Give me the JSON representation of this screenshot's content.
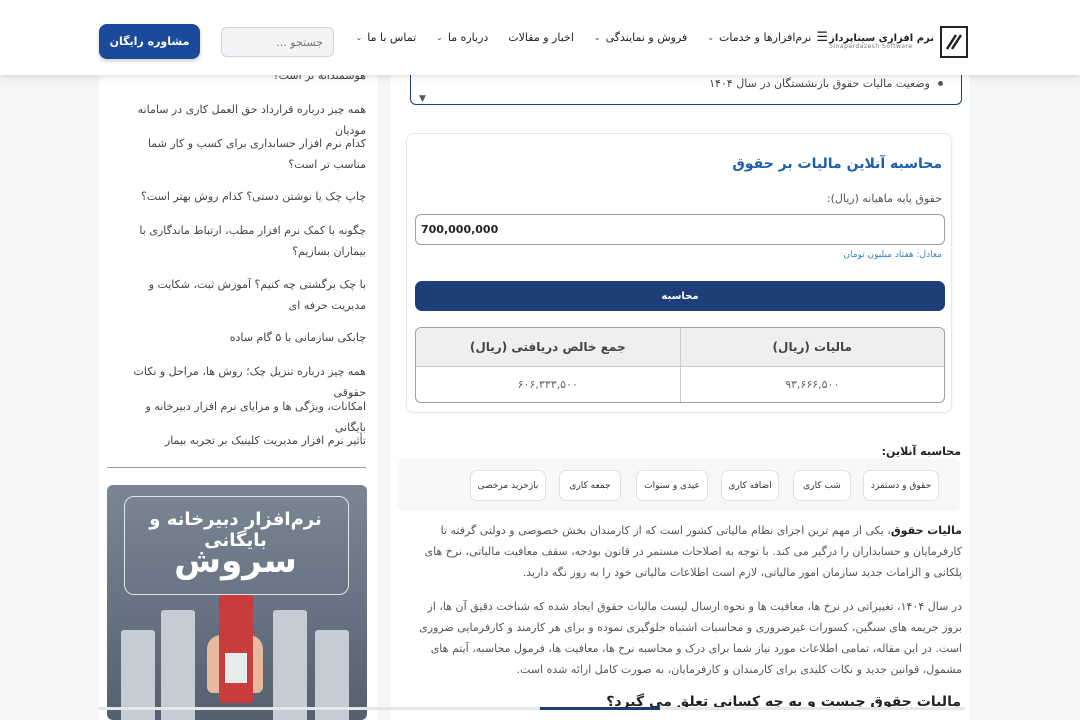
{
  "header": {
    "logo_fa": "نرم افزاری سیناپرداز",
    "logo_en": "Sinapardazesh Software",
    "nav": [
      {
        "label": "نرم‌افزارها و خدمات",
        "has_dropdown": true
      },
      {
        "label": "فروش و نمایندگی",
        "has_dropdown": true
      },
      {
        "label": "اخبار و مقالات",
        "has_dropdown": false
      },
      {
        "label": "درباره ما",
        "has_dropdown": true
      },
      {
        "label": "تماس با ما",
        "has_dropdown": true
      }
    ],
    "search_placeholder": "جستجو ...",
    "cta_label": "مشاوره رایگان",
    "accent_color": "#1b4a9a"
  },
  "toc": {
    "item": "وضعیت مالیات حقوق بازنشستگان در سال ۱۴۰۴"
  },
  "calculator": {
    "title": "محاسبه آنلاین مالیات بر حقوق",
    "input_label": "حقوق پایه ماهیانه (ریال):",
    "input_value": "700,000,000",
    "equivalent": "معادل: هفتاد میلیون تومان",
    "button_label": "محاسبه",
    "result_headers": [
      "مالیات (ریال)",
      "جمع خالص دریافتی (ریال)"
    ],
    "result_values": [
      "۹۳,۶۶۶,۵۰۰",
      "۶۰۶,۳۳۳,۵۰۰"
    ],
    "button_color": "#1e3e79"
  },
  "online_calc": {
    "title": "محاسبه آنلاین:",
    "chips": [
      "حقوق و دستمزد",
      "شب کاری",
      "اضافه کاری",
      "عیدی و سنوات",
      "جمعه کاری",
      "بازخرید مرخصی"
    ]
  },
  "article": {
    "p1_bold": "مالیات حقوق",
    "p1_line1": "، یکی از مهم ترین اجزای نظام مالیاتی کشور است که از کارمندان بخش خصوصی و دولتی گرفته تا",
    "p1_line2": "کارفرمایان و حسابداران را درگیر می کند. با توجه به اصلاحات مستمر در قانون بودجه، سقف معافیت مالیاتی، نرخ های",
    "p1_line3": "پلکانی و الزامات جدید سازمان امور مالیاتی، لازم است اطلاعات مالیاتی خود را به روز نگه دارید.",
    "p2_line1": "در سال ۱۴۰۴، تغییراتی در نرخ ها، معافیت ها و نحوه ارسال لیست مالیات حقوق ایجاد شده که شناخت دقیق آن ها، از",
    "p2_line2": "بروز جریمه های سنگین، کسورات غیرضروری و محاسبات اشتباه جلوگیری نموده و برای هر کارمند و کارفرمایی ضروری",
    "p2_line3": "است. در این مقاله، تمامی اطلاعات مورد نیاز شما برای درک و محاسبه نرخ ها، معافیت ها، فرمول محاسبه، آیتم های",
    "p2_line4": "مشمول، قوانین جدید و نکات کلیدی برای کارمندان و کارفرمایان، به صورت کامل ارائه شده است.",
    "h2": "مالیات حقوق چیست و به چه کسانی تعلق می گیرد؟"
  },
  "sidebar": {
    "items": [
      "هوشمندانه تر است؟",
      "همه چیز درباره قرارداد حق العمل کاری در سامانه مودیان",
      "کدام نرم افزار حسابداری برای کسب و کار شما مناسب تر است؟",
      "چاپ چک یا نوشتن دستی؟ کدام روش بهتر است؟",
      "چگونه با کمک نرم افزار مطب، ارتباط ماندگاری با بیماران بسازیم؟",
      "با چک برگشتی چه کنیم؟ آموزش ثبت، شکایت و مدیریت حرفه ای",
      "چابکی سازمانی با ۵ گام ساده",
      "همه چیز درباره تنزیل چک؛ روش ها، مراحل و نکات حقوقی",
      "امکانات، ویژگی ها و مزایای نرم افزار دبیرخانه و بایگانی",
      "تأثیر نرم افزار مدیریت کلینیک بر تجربه بیمار"
    ],
    "banner_sub": "نرم‌افزار دبیرخانه و بایگانی",
    "banner_main": "سروش"
  }
}
